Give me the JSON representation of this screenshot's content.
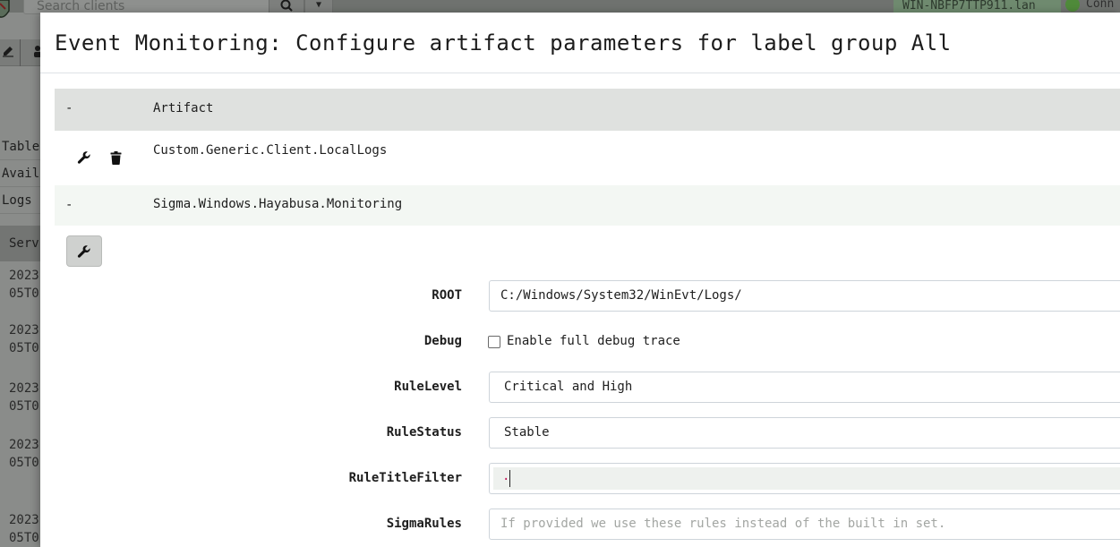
{
  "background": {
    "search_placeholder": "Search clients",
    "hostname": "WIN-NBFP7TTP911.lan",
    "connection_status": "Conn",
    "menu_items": [
      "Table",
      "Avail",
      "Logs"
    ],
    "server_header": "Serv",
    "log_rows": [
      {
        "year": "2023",
        "rest": "05T0"
      },
      {
        "year": "2023",
        "rest": "05T0"
      },
      {
        "year": "2023",
        "rest": "05T0"
      },
      {
        "year": "2023",
        "rest": "05T0"
      },
      {
        "year": "2023",
        "rest": "05T0"
      }
    ]
  },
  "modal": {
    "title": "Event Monitoring: Configure artifact parameters for label group All",
    "table_header": {
      "collapse": "-",
      "column": "Artifact"
    },
    "artifacts": [
      {
        "name": "Custom.Generic.Client.LocalLogs"
      },
      {
        "collapse": "-",
        "name": "Sigma.Windows.Hayabusa.Monitoring"
      }
    ],
    "parameters": {
      "root": {
        "label": "ROOT",
        "value": "C:/Windows/System32/WinEvt/Logs/"
      },
      "debug": {
        "label": "Debug",
        "checkbox_label": "Enable full debug trace",
        "checked": false
      },
      "rule_level": {
        "label": "RuleLevel",
        "value": "Critical and High"
      },
      "rule_status": {
        "label": "RuleStatus",
        "value": "Stable"
      },
      "rule_title_filter": {
        "label": "RuleTitleFilter",
        "value": "."
      },
      "sigma_rules": {
        "label": "SigmaRules",
        "placeholder": "If provided we use these rules instead of the built in set."
      }
    }
  },
  "icons": {
    "wrench": "wrench-icon",
    "trash": "trash-icon",
    "search": "search-icon",
    "caret": "caret-down-icon"
  },
  "colors": {
    "backdrop": "#8a8c8a",
    "table_header": "#dfe1df",
    "subheader": "#f3f7f3",
    "editor_dot": "#c2185b",
    "connection_dot": "#4f8a3a"
  }
}
